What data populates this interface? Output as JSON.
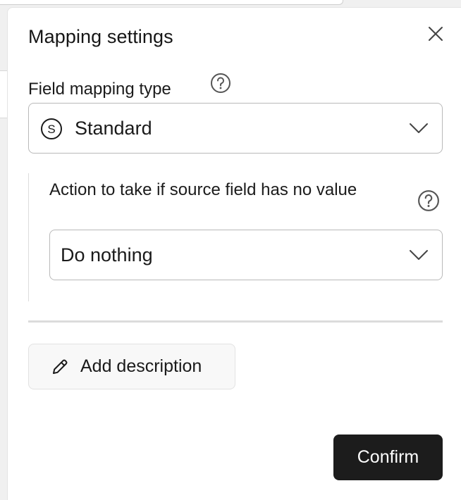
{
  "dialog": {
    "title": "Mapping settings",
    "close_icon": "close-icon"
  },
  "field_mapping": {
    "label": "Field mapping type",
    "help_icon": "help-circle-icon",
    "selected_icon": "standard-s-icon",
    "selected_value": "Standard",
    "dropdown_icon": "chevron-down-icon"
  },
  "empty_value_action": {
    "label": "Action to take if source field has no value",
    "help_icon": "help-circle-icon",
    "selected_value": "Do nothing",
    "dropdown_icon": "chevron-down-icon"
  },
  "add_description": {
    "icon": "pencil-icon",
    "label": "Add description"
  },
  "footer": {
    "confirm_label": "Confirm"
  },
  "colors": {
    "confirm_bg": "#1c1c1c",
    "confirm_text": "#ffffff",
    "border": "#b9b9b9",
    "divider": "#dcdcdc"
  }
}
